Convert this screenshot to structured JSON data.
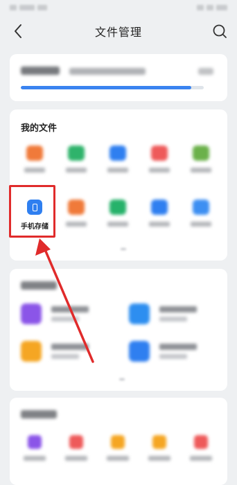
{
  "page": {
    "title": "文件管理"
  },
  "colors": {
    "accent": "#3a83f0",
    "highlight": "#e02b2b",
    "background": "#eef0f2"
  },
  "icons": {
    "back": "chevron-left-icon",
    "search": "search-icon",
    "phone_storage": "phone-icon"
  },
  "storage": {
    "used_fraction": 0.93
  },
  "my_files": {
    "title": "我的文件",
    "items": [
      {
        "label": "",
        "color": "#f07a3a"
      },
      {
        "label": "",
        "color": "#2fb36b"
      },
      {
        "label": "",
        "color": "#2f7ff0"
      },
      {
        "label": "",
        "color": "#ee5a5a"
      },
      {
        "label": "",
        "color": "#6bb14a"
      },
      {
        "label": "手机存储",
        "color": "#2f7ff0",
        "focus": true
      },
      {
        "label": "",
        "color": "#f07a3a"
      },
      {
        "label": "",
        "color": "#26b26a"
      },
      {
        "label": "",
        "color": "#2f7ff0"
      },
      {
        "label": "",
        "color": "#3d8ff2"
      }
    ]
  },
  "tools": {
    "items": [
      {
        "color": "#8b55e8"
      },
      {
        "color": "#2d8ef0"
      },
      {
        "color": "#f5a623"
      },
      {
        "color": "#2f7ff0"
      }
    ]
  },
  "other_tools": {
    "items": [
      {
        "color": "#8b55e8"
      },
      {
        "color": "#ee5a5a"
      },
      {
        "color": "#f5a623"
      },
      {
        "color": "#f5a623"
      },
      {
        "color": "#ee5a5a"
      }
    ]
  }
}
